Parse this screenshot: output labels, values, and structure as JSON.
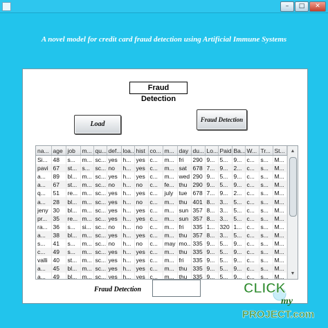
{
  "window": {
    "minimize": "–",
    "maximize": "□",
    "close": "✕"
  },
  "heading": "A novel model for credit card fraud detection using Artificial Immune Systems",
  "panel": {
    "title": "Fraud Detection"
  },
  "buttons": {
    "load": "Load",
    "fraud_detection": "Fraud Detection"
  },
  "table": {
    "columns": [
      "na...",
      "age",
      "job",
      "m...",
      "qu...",
      "def...",
      "loa...",
      "hist",
      "co...",
      "m...",
      "day",
      "du...",
      "Lo...",
      "Paid",
      "Ba...",
      "W...",
      "Tr...",
      "St..."
    ],
    "rows": [
      [
        "Si...",
        "48",
        "s...",
        "m...",
        "sc...",
        "yes",
        "h...",
        "yes",
        "c...",
        "m...",
        "fri",
        "290",
        "9...",
        "5...",
        "9...",
        "c...",
        "s...",
        "M..."
      ],
      [
        "pavi",
        "67",
        "st...",
        "s...",
        "sc...",
        "no",
        "h...",
        "yes",
        "c...",
        "m...",
        "sat",
        "678",
        "7...",
        "9...",
        "2...",
        "c...",
        "s...",
        "M..."
      ],
      [
        "a...",
        "89",
        "bl...",
        "m...",
        "sc...",
        "yes",
        "h...",
        "yes",
        "c...",
        "m...",
        "wed",
        "290",
        "9...",
        "5...",
        "9...",
        "c...",
        "s...",
        "M..."
      ],
      [
        "a...",
        "67",
        "st...",
        "m...",
        "sc...",
        "no",
        "h...",
        "no",
        "c...",
        "fe...",
        "thu",
        "290",
        "9...",
        "5...",
        "9...",
        "c...",
        "s...",
        "M..."
      ],
      [
        "q...",
        "51",
        "re...",
        "m...",
        "sc...",
        "yes",
        "h...",
        "yes",
        "c...",
        "july",
        "tue",
        "678",
        "7...",
        "9...",
        "2...",
        "c...",
        "s...",
        "M..."
      ],
      [
        "a...",
        "28",
        "bl...",
        "m...",
        "sc...",
        "yes",
        "h...",
        "no",
        "c...",
        "m...",
        "thu",
        "401",
        "8...",
        "3...",
        "5...",
        "c...",
        "s...",
        "M..."
      ],
      [
        "jeny",
        "30",
        "bl...",
        "m...",
        "sc...",
        "yes",
        "h...",
        "yes",
        "c...",
        "m...",
        "sun",
        "357",
        "8...",
        "3...",
        "5...",
        "c...",
        "s...",
        "M..."
      ],
      [
        "pr...",
        "35",
        "re...",
        "m...",
        "sc...",
        "yes",
        "h...",
        "yes",
        "c...",
        "m...",
        "sun",
        "357",
        "8...",
        "3...",
        "5...",
        "c...",
        "s...",
        "M..."
      ],
      [
        "ra...",
        "36",
        "s...",
        "si...",
        "sc...",
        "no",
        "h...",
        "no",
        "c...",
        "m...",
        "fri",
        "335",
        "1...",
        "320",
        "1...",
        "c...",
        "s...",
        "M..."
      ],
      [
        "a...",
        "38",
        "bl...",
        "m...",
        "sc...",
        "yes",
        "h...",
        "yes",
        "c...",
        "m...",
        "thu",
        "357",
        "8...",
        "3...",
        "5...",
        "c...",
        "s...",
        "M..."
      ],
      [
        "s...",
        "41",
        "s...",
        "m...",
        "sc...",
        "no",
        "h...",
        "no",
        "c...",
        "may",
        "mo...",
        "335",
        "9...",
        "5...",
        "9...",
        "c...",
        "s...",
        "M..."
      ],
      [
        "c...",
        "49",
        "s...",
        "m...",
        "sc...",
        "yes",
        "h...",
        "yes",
        "c...",
        "m...",
        "thu",
        "335",
        "9...",
        "5...",
        "9...",
        "c...",
        "s...",
        "M..."
      ],
      [
        "valli",
        "40",
        "st...",
        "m...",
        "sc...",
        "yes",
        "h...",
        "yes",
        "c...",
        "m...",
        "fri",
        "335",
        "9...",
        "5...",
        "9...",
        "c...",
        "s...",
        "M..."
      ],
      [
        "a...",
        "45",
        "bl...",
        "m...",
        "sc...",
        "yes",
        "h...",
        "yes",
        "c...",
        "m...",
        "thu",
        "335",
        "9...",
        "5...",
        "9...",
        "c...",
        "s...",
        "M..."
      ],
      [
        "a...",
        "49",
        "bl...",
        "m...",
        "sc...",
        "yes",
        "h...",
        "yes",
        "c...",
        "m...",
        "thu",
        "335",
        "9...",
        "5...",
        "9...",
        "c...",
        "s...",
        "M..."
      ]
    ]
  },
  "bottom": {
    "label": "Fraud Detection",
    "result_value": ""
  },
  "watermark": {
    "line1": "CLICK",
    "line2": "my",
    "line3": "PROJECT.com"
  },
  "colors": {
    "background": "#22c4ec",
    "panel": "#ffffff",
    "logo_green": "#2e8b2e"
  }
}
